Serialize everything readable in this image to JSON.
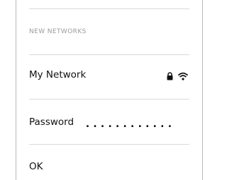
{
  "section": {
    "header": "NEW NETWORKS"
  },
  "network": {
    "name": "My Network",
    "icons": [
      "lock-icon",
      "wifi-icon"
    ]
  },
  "password": {
    "label": "Password",
    "value": "............"
  },
  "ok": {
    "label": "OK"
  }
}
